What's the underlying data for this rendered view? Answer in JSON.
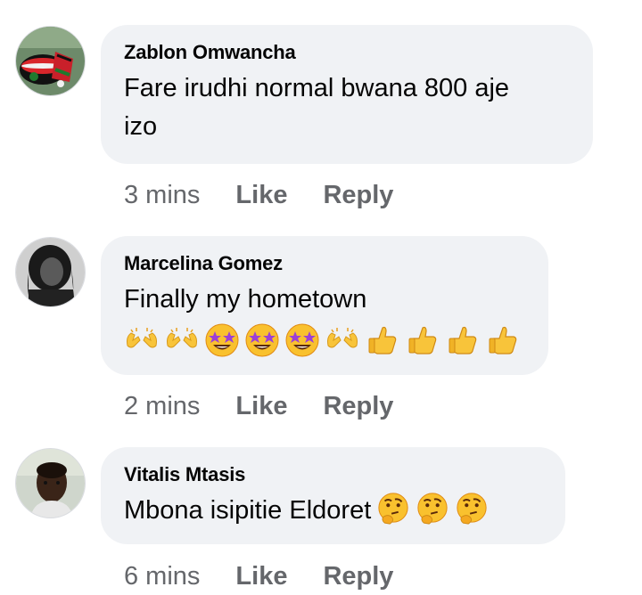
{
  "comments": [
    {
      "author": "Zablon Omwancha",
      "text_line1": "Fare irudhi normal bwana 800 aje",
      "text_line2": "izo",
      "time": "3 mins",
      "like_label": "Like",
      "reply_label": "Reply",
      "avatar_icon": "avatar-kenyan-flag-bracelet"
    },
    {
      "author": "Marcelina Gomez",
      "text": "Finally my hometown",
      "emojis": [
        "raising-hands-icon",
        "raising-hands-icon",
        "star-struck-icon",
        "star-struck-icon",
        "star-struck-icon",
        "raising-hands-icon",
        "thumbs-up-icon",
        "thumbs-up-icon",
        "thumbs-up-icon",
        "thumbs-up-icon"
      ],
      "time": "2 mins",
      "like_label": "Like",
      "reply_label": "Reply",
      "avatar_icon": "avatar-person-grayscale"
    },
    {
      "author": "Vitalis Mtasis",
      "text": "Mbona isipitie Eldoret",
      "emojis": [
        "thinking-face-icon",
        "thinking-face-icon",
        "thinking-face-icon"
      ],
      "time": "6 mins",
      "like_label": "Like",
      "reply_label": "Reply",
      "avatar_icon": "avatar-person-photo"
    }
  ],
  "colors": {
    "bubble_bg": "#f0f2f5",
    "text": "#050505",
    "meta_text": "#65676b"
  }
}
